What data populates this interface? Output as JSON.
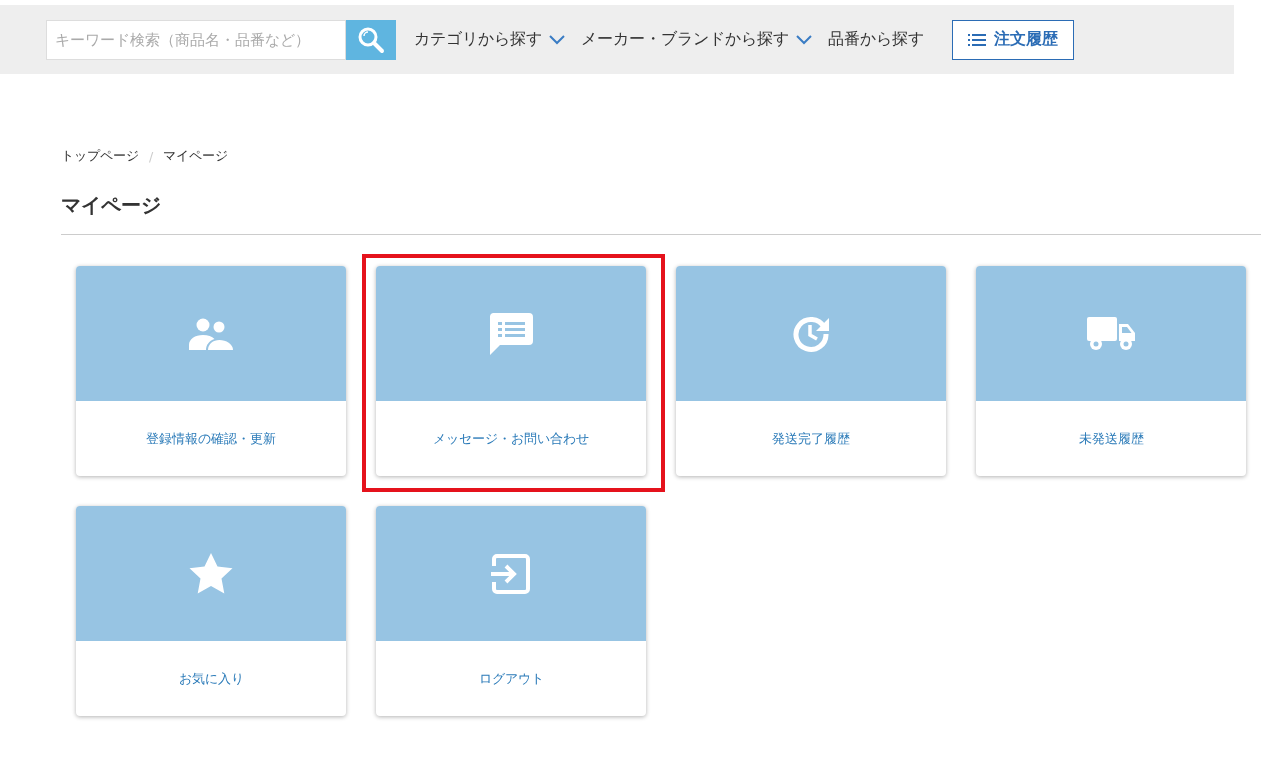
{
  "header": {
    "search": {
      "placeholder": "キーワード検索（商品名・品番など）"
    },
    "nav": [
      {
        "label": "カテゴリから探す",
        "dropdown": true
      },
      {
        "label": "メーカー・ブランドから探す",
        "dropdown": true
      },
      {
        "label": "品番から探す",
        "dropdown": false
      }
    ],
    "order_history_button": "注文履歴"
  },
  "breadcrumb": {
    "items": [
      "トップページ",
      "マイページ"
    ],
    "separator": "/"
  },
  "page_title": "マイページ",
  "cards": [
    {
      "kind": "users",
      "label": "登録情報の確認・更新",
      "highlighted": false
    },
    {
      "kind": "message",
      "label": "メッセージ・お問い合わせ",
      "highlighted": true
    },
    {
      "kind": "history",
      "label": "発送完了履歴",
      "highlighted": false
    },
    {
      "kind": "truck",
      "label": "未発送履歴",
      "highlighted": false
    },
    {
      "kind": "star",
      "label": "お気に入り",
      "highlighted": false
    },
    {
      "kind": "logout",
      "label": "ログアウト",
      "highlighted": false
    }
  ]
}
